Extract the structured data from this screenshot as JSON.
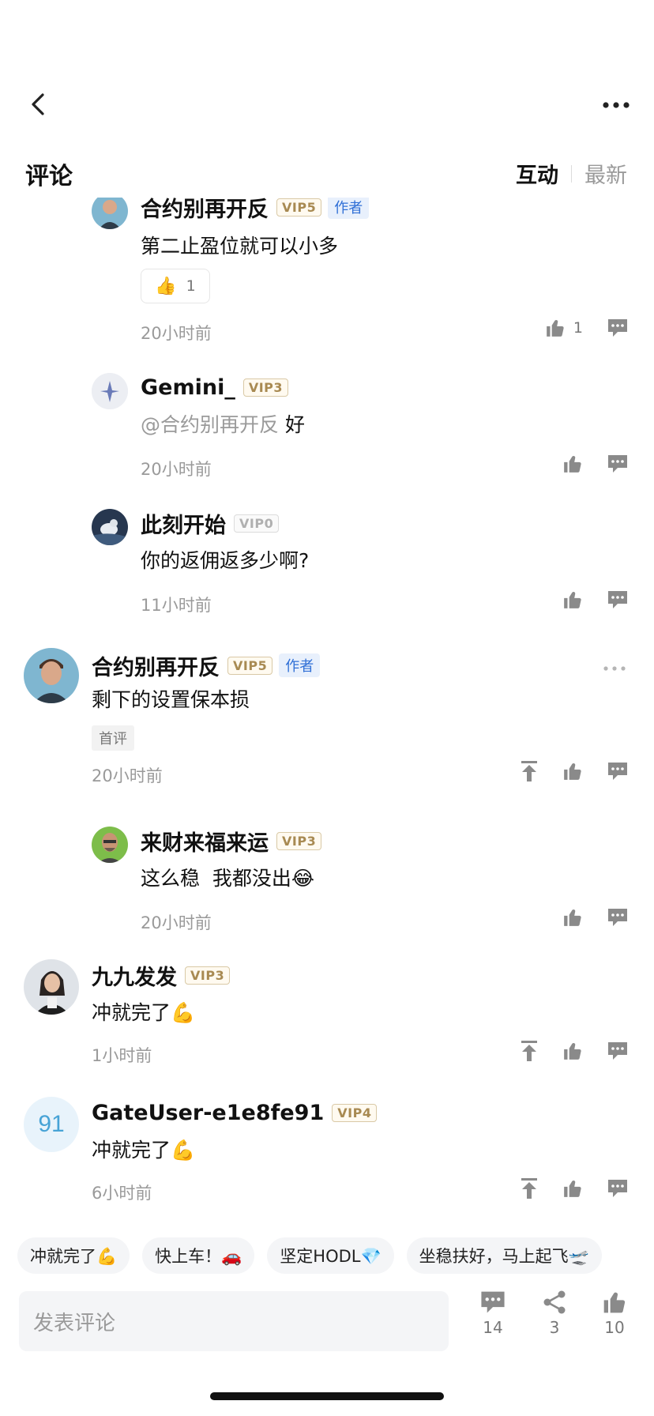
{
  "header": {
    "title": "评论",
    "sort_tabs": [
      "互动",
      "最新"
    ],
    "active_sort": "互动"
  },
  "comments": [
    {
      "user": "合约别再开反",
      "vip": "VIP5",
      "author_tag": "作者",
      "text": "第二止盈位就可以小多",
      "reaction": {
        "emoji": "👍",
        "count": "1"
      },
      "time": "20小时前",
      "likes": "1"
    },
    {
      "user": "Gemini_",
      "vip": "VIP3",
      "mention": "@合约别再开反",
      "text": " 好",
      "time": "20小时前"
    },
    {
      "user": "此刻开始",
      "vip": "VIP0",
      "text": "你的返佣返多少啊?",
      "time": "11小时前"
    },
    {
      "user": "合约别再开反",
      "vip": "VIP5",
      "author_tag": "作者",
      "text": "剩下的设置保本损",
      "tag": "首评",
      "time": "20小时前"
    },
    {
      "user": "来财来福来运",
      "vip": "VIP3",
      "text": "这么稳  我都没出😂",
      "time": "20小时前"
    },
    {
      "user": "九九发发",
      "vip": "VIP3",
      "text": "冲就完了💪",
      "time": "1小时前"
    },
    {
      "user": "GateUser-e1e8fe91",
      "vip": "VIP4",
      "avatar_text": "91",
      "text": "冲就完了💪",
      "time": "6小时前"
    }
  ],
  "quick_replies": [
    "冲就完了💪",
    "快上车！🚗",
    "坚定HODL💎",
    "坐稳扶好，马上起飞🛫"
  ],
  "bottom": {
    "input_placeholder": "发表评论",
    "comment_count": "14",
    "share_count": "3",
    "like_count": "10"
  },
  "colors": {
    "vip_gold": "#a88a52",
    "author_blue": "#2f6fd6",
    "muted": "#9a9a9a"
  }
}
